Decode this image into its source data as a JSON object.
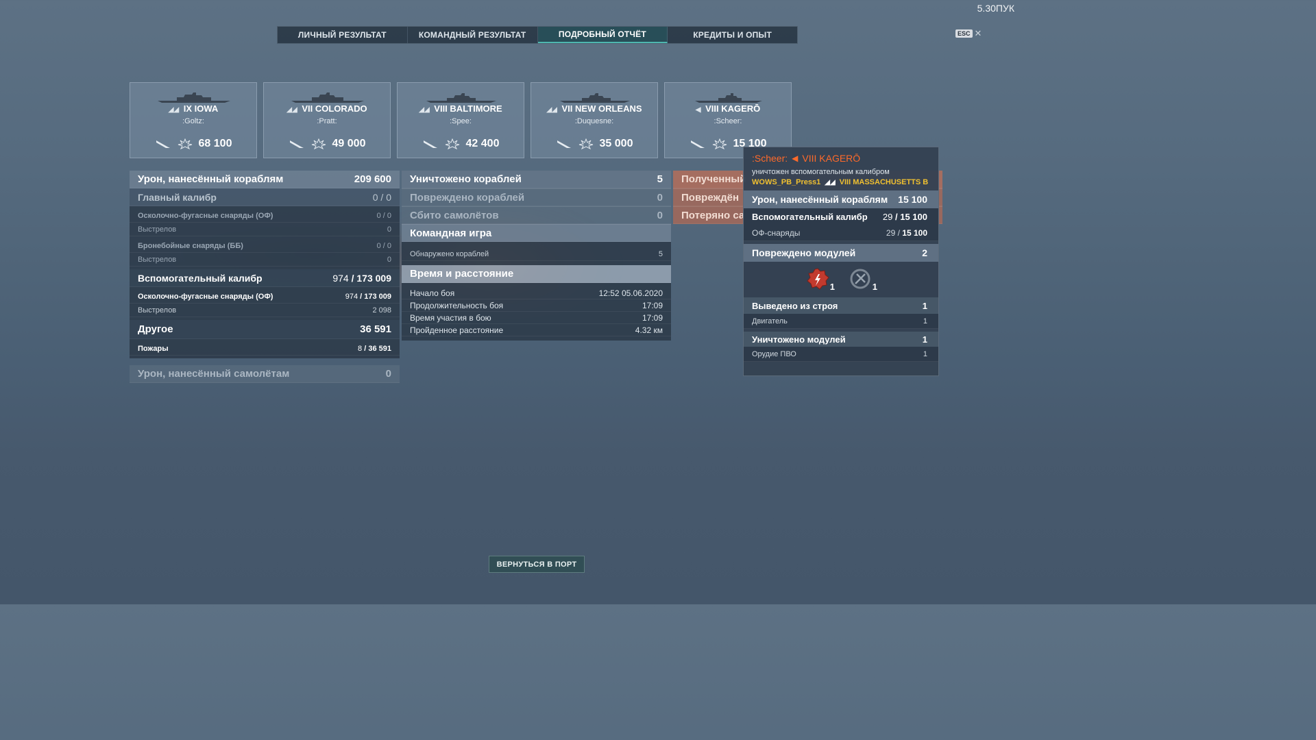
{
  "header": {
    "points": "5.30ПУК",
    "esc_label": "ESC",
    "tabs": [
      "ЛИЧНЫЙ РЕЗУЛЬТАТ",
      "КОМАНДНЫЙ РЕЗУЛЬТАТ",
      "ПОДРОБНЫЙ ОТЧЁТ",
      "КРЕДИТЫ И ОПЫТ"
    ],
    "active_tab": 2
  },
  "ships": [
    {
      "tier": "IX",
      "name": "IOWA",
      "player": ":Goltz:",
      "damage": "68 100",
      "class_icon": "battleship-icon"
    },
    {
      "tier": "VII",
      "name": "COLORADO",
      "player": ":Pratt:",
      "damage": "49 000",
      "class_icon": "battleship-icon"
    },
    {
      "tier": "VIII",
      "name": "BALTIMORE",
      "player": ":Spee:",
      "damage": "42 400",
      "class_icon": "cruiser-icon"
    },
    {
      "tier": "VII",
      "name": "NEW ORLEANS",
      "player": ":Duquesne:",
      "damage": "35 000",
      "class_icon": "cruiser-icon"
    },
    {
      "tier": "VIII",
      "name": "KAGERŌ",
      "player": ":Scheer:",
      "damage": "15 100",
      "class_icon": "destroyer-icon"
    }
  ],
  "left": {
    "damage_ships": {
      "label": "Урон, нанесённый кораблям",
      "value": "209 600"
    },
    "main_caliber": {
      "label": "Главный калибр",
      "value": "0 / 0"
    },
    "he_main": {
      "label": "Осколочно-фугасные снаряды (ОФ)",
      "value": "0 / 0"
    },
    "he_main_shots": {
      "label": "Выстрелов",
      "value": "0"
    },
    "ap_main": {
      "label": "Бронебойные снаряды (ББ)",
      "value": "0 / 0"
    },
    "ap_main_shots": {
      "label": "Выстрелов",
      "value": "0"
    },
    "secondary": {
      "label": "Вспомогательный калибр",
      "value_a": "974",
      "value_b": "173 009"
    },
    "he_secondary": {
      "label": "Осколочно-фугасные снаряды (ОФ)",
      "value_a": "974",
      "value_b": "173 009"
    },
    "he_secondary_shots": {
      "label": "Выстрелов",
      "value": "2 098"
    },
    "other": {
      "label": "Другое",
      "value": "36 591"
    },
    "fires": {
      "label": "Пожары",
      "value_a": "8",
      "value_b": "36 591"
    },
    "damage_planes": {
      "label": "Урон, нанесённый самолётам",
      "value": "0"
    }
  },
  "middle": {
    "destroyed": {
      "label": "Уничтожено кораблей",
      "value": "5"
    },
    "damaged": {
      "label": "Повреждено кораблей",
      "value": "0"
    },
    "planes": {
      "label": "Сбито самолётов",
      "value": "0"
    },
    "team_play": {
      "label": "Командная игра"
    },
    "spotted": {
      "label": "Обнаружено кораблей",
      "value": "5"
    },
    "time_distance": {
      "label": "Время и расстояние"
    },
    "battle_start": {
      "label": "Начало боя",
      "value": "12:52  05.06.2020"
    },
    "battle_duration": {
      "label": "Продолжительность боя",
      "value": "17:09"
    },
    "participation": {
      "label": "Время участия в бою",
      "value": "17:09"
    },
    "distance": {
      "label": "Пройденное расстояние",
      "value": "4.32 км"
    }
  },
  "right": {
    "received": "Полученный",
    "damaged_recv": "Повреждён",
    "lost": "Потеряно са"
  },
  "tooltip": {
    "player": ":Scheer:",
    "ship": "VIII KAGERŌ",
    "description": "уничтожен вспомогательным калибром",
    "killer_player": "WOWS_PB_Press1",
    "killer_ship": "VIII MASSACHUSETTS B",
    "damage": {
      "label": "Урон, нанесённый кораблям",
      "value": "15 100"
    },
    "secondary": {
      "label": "Вспомогательный калибр",
      "value_a": "29",
      "value_b": "15 100"
    },
    "he": {
      "label": "ОФ-снаряды",
      "value_a": "29",
      "value_b": "15 100"
    },
    "modules_damaged": {
      "label": "Повреждено модулей",
      "value": "2"
    },
    "module_counts": [
      "1",
      "1"
    ],
    "disabled": {
      "label": "Выведено из строя",
      "value": "1"
    },
    "engine": {
      "label": "Двигатель",
      "value": "1"
    },
    "modules_destroyed": {
      "label": "Уничтожено модулей",
      "value": "1"
    },
    "aa_gun": {
      "label": "Орудие ПВО",
      "value": "1"
    }
  },
  "footer": {
    "return_label": "ВЕРНУТЬСЯ В ПОРТ"
  },
  "colors": {
    "accent_orange": "#ff6a2a",
    "killer_yellow": "#f0c030",
    "active_tab": "#4fb8b0"
  }
}
